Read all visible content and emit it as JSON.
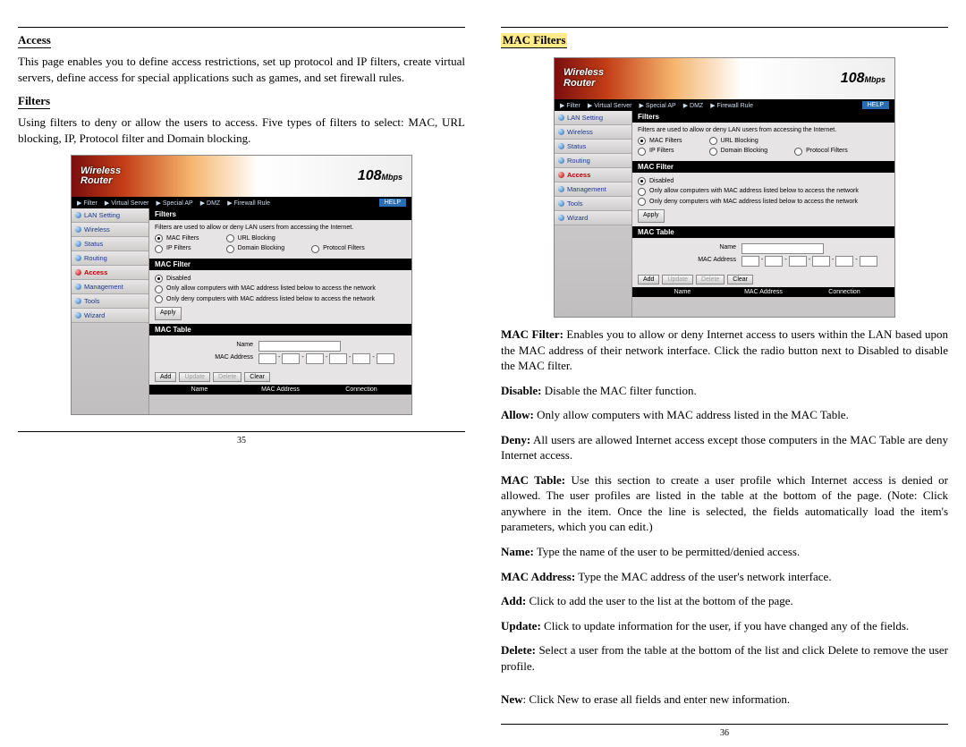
{
  "left": {
    "heading_access": "Access",
    "access_body": "This page enables you to define access restrictions, set up protocol and IP filters, create virtual servers, define access for special applications such as games, and set firewall rules.",
    "heading_filters": "Filters",
    "filters_body": "Using filters to deny or allow the users to access.  Five types of filters to select: MAC, URL blocking, IP, Protocol filter and Domain blocking.",
    "page_num": "35"
  },
  "right": {
    "heading_mac": "MAC Filters",
    "p_macfilter_label": "MAC Filter:",
    "p_macfilter": " Enables you to allow or deny Internet access to users within the LAN based upon the MAC address of their network interface. Click the radio button next to Disabled to disable the MAC filter.",
    "p_disable_label": "Disable:",
    "p_disable": " Disable the MAC filter function.",
    "p_allow_label": "Allow:",
    "p_allow": " Only allow computers with MAC address listed in the MAC Table.",
    "p_deny_label": "Deny:",
    "p_deny": " All users are allowed Internet access except those computers in the MAC Table are deny Internet access.",
    "p_mactable_label": "MAC Table:",
    "p_mactable": " Use this section to create a user profile which Internet access is denied or allowed.  The user profiles are listed in the table at the bottom of the page.  (Note: Click anywhere in the item. Once the line is selected, the fields automatically load the item's parameters, which you can edit.)",
    "p_name_label": "Name:",
    "p_name": " Type the name of the user to be permitted/denied access.",
    "p_macaddr_label": "MAC Address:",
    "p_macaddr": " Type the MAC address of the user's network interface.",
    "p_add_label": "Add:",
    "p_add": " Click to add the user to the list at the bottom of the page.",
    "p_update_label": "Update:",
    "p_update": " Click to update information for the user, if you have changed any of the fields.",
    "p_delete_label": "Delete:",
    "p_delete": " Select a user from the table at the bottom of the list and click Delete to remove the user profile.",
    "p_new_label": "New",
    "p_new": ": Click New to erase all fields and enter new information.",
    "page_num": "36"
  },
  "router": {
    "brand_l1": "Wireless",
    "brand_l2": "Router",
    "speed": "108",
    "speed_unit": "Mbps",
    "nav": {
      "a": "▶ Filter",
      "b": "▶ Virtual Server",
      "c": "▶ Special AP",
      "d": "▶ DMZ",
      "e": "▶ Firewall Rule"
    },
    "help": "HELP",
    "sidebar": {
      "lan": "LAN Setting",
      "wireless": "Wireless",
      "status": "Status",
      "routing": "Routing",
      "access": "Access",
      "mgmt": "Management",
      "tools": "Tools",
      "wizard": "Wizard"
    },
    "filters_head": "Filters",
    "filters_note": "Filters are used to allow or deny LAN users from accessing the Internet.",
    "opt_mac": "MAC Filters",
    "opt_url": "URL Blocking",
    "opt_ip": "IP Filters",
    "opt_domain": "Domain Blocking",
    "opt_proto": "Protocol Filters",
    "macfilter_head": "MAC Filter",
    "opt_disabled": "Disabled",
    "opt_allow": "Only allow computers with MAC address listed below to access the network",
    "opt_deny": "Only deny computers with MAC address listed below to access the network",
    "btn_apply": "Apply",
    "mactable_head": "MAC Table",
    "lbl_name": "Name",
    "lbl_mac": "MAC Address",
    "btn_add": "Add",
    "btn_update": "Update",
    "btn_delete": "Delete",
    "btn_clear": "Clear",
    "th_name": "Name",
    "th_mac": "MAC Address",
    "th_conn": "Connection"
  }
}
